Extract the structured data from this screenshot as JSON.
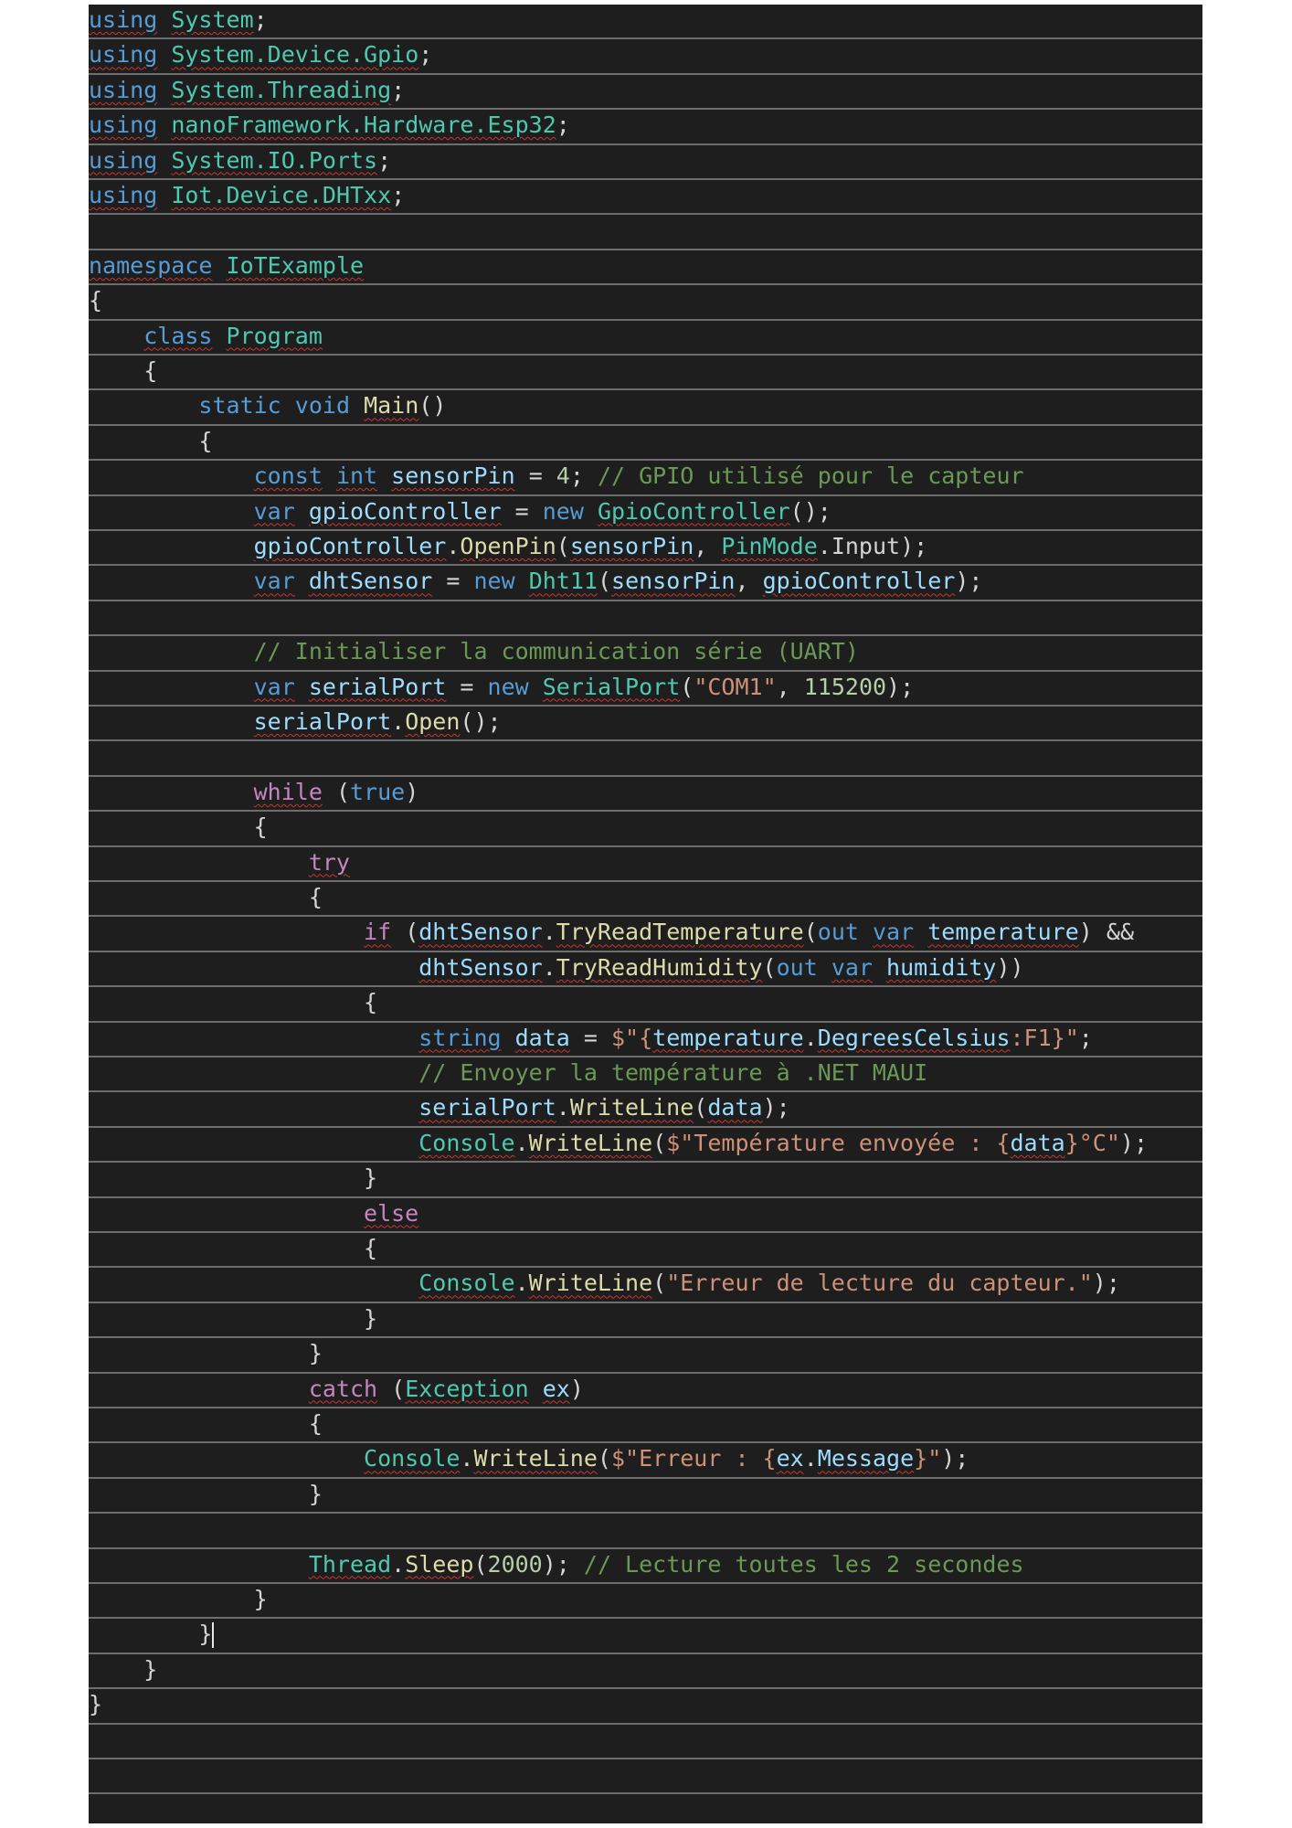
{
  "editor": {
    "background": "#1e1e1e",
    "line_separator_color": "#6e6e6e",
    "token_colors": {
      "keyword": "#569cd6",
      "control": "#c586c0",
      "type": "#4ec9b0",
      "method": "#dcdcaa",
      "variable": "#9cdcfe",
      "string": "#ce9178",
      "number": "#b5cea8",
      "comment": "#6a9955",
      "plain": "#d4d4d4"
    },
    "lines": [
      [
        [
          "kw",
          "using"
        ],
        [
          "plain",
          " "
        ],
        [
          "type",
          "System"
        ],
        [
          "plain",
          ";"
        ]
      ],
      [
        [
          "kw",
          "using"
        ],
        [
          "plain",
          " "
        ],
        [
          "type",
          "System.Device.Gpio"
        ],
        [
          "plain",
          ";"
        ]
      ],
      [
        [
          "kw",
          "using"
        ],
        [
          "plain",
          " "
        ],
        [
          "type",
          "System.Threading"
        ],
        [
          "plain",
          ";"
        ]
      ],
      [
        [
          "kw",
          "using"
        ],
        [
          "plain",
          " "
        ],
        [
          "type",
          "nanoFramework.Hardware.Esp32"
        ],
        [
          "plain",
          ";"
        ]
      ],
      [
        [
          "kw",
          "using"
        ],
        [
          "plain",
          " "
        ],
        [
          "type",
          "System.IO.Ports"
        ],
        [
          "plain",
          ";"
        ]
      ],
      [
        [
          "kw",
          "using"
        ],
        [
          "plain",
          " "
        ],
        [
          "type",
          "Iot.Device.DHTxx"
        ],
        [
          "plain",
          ";"
        ]
      ],
      [],
      [
        [
          "kw",
          "namespace"
        ],
        [
          "plain",
          " "
        ],
        [
          "type",
          "IoTExample"
        ]
      ],
      [
        [
          "plain",
          "{"
        ]
      ],
      [
        [
          "plain",
          "    "
        ],
        [
          "kw",
          "class"
        ],
        [
          "plain",
          " "
        ],
        [
          "type",
          "Program"
        ]
      ],
      [
        [
          "plain",
          "    {"
        ]
      ],
      [
        [
          "plain",
          "        "
        ],
        [
          "kw",
          "static"
        ],
        [
          "plain",
          " "
        ],
        [
          "kw",
          "void"
        ],
        [
          "plain",
          " "
        ],
        [
          "meth",
          "Main"
        ],
        [
          "plain",
          "()"
        ]
      ],
      [
        [
          "plain",
          "        {"
        ]
      ],
      [
        [
          "plain",
          "            "
        ],
        [
          "kw",
          "const"
        ],
        [
          "plain",
          " "
        ],
        [
          "kw",
          "int"
        ],
        [
          "plain",
          " "
        ],
        [
          "var",
          "sensorPin"
        ],
        [
          "plain",
          " = "
        ],
        [
          "num",
          "4"
        ],
        [
          "plain",
          "; "
        ],
        [
          "cmt",
          "// GPIO utilisé pour le capteur"
        ]
      ],
      [
        [
          "plain",
          "            "
        ],
        [
          "kw",
          "var"
        ],
        [
          "plain",
          " "
        ],
        [
          "var",
          "gpioController"
        ],
        [
          "plain",
          " = "
        ],
        [
          "kw",
          "new"
        ],
        [
          "plain",
          " "
        ],
        [
          "type",
          "GpioController"
        ],
        [
          "plain",
          "();"
        ]
      ],
      [
        [
          "plain",
          "            "
        ],
        [
          "var",
          "gpioController"
        ],
        [
          "plain",
          "."
        ],
        [
          "meth",
          "OpenPin"
        ],
        [
          "plain",
          "("
        ],
        [
          "var",
          "sensorPin"
        ],
        [
          "plain",
          ", "
        ],
        [
          "type",
          "PinMode"
        ],
        [
          "plain",
          ".Input);"
        ]
      ],
      [
        [
          "plain",
          "            "
        ],
        [
          "kw",
          "var"
        ],
        [
          "plain",
          " "
        ],
        [
          "var",
          "dhtSensor"
        ],
        [
          "plain",
          " = "
        ],
        [
          "kw",
          "new"
        ],
        [
          "plain",
          " "
        ],
        [
          "type",
          "Dht11"
        ],
        [
          "plain",
          "("
        ],
        [
          "var",
          "sensorPin"
        ],
        [
          "plain",
          ", "
        ],
        [
          "var",
          "gpioController"
        ],
        [
          "plain",
          ");"
        ]
      ],
      [],
      [
        [
          "plain",
          "            "
        ],
        [
          "cmt",
          "// Initialiser la communication série (UART)"
        ]
      ],
      [
        [
          "plain",
          "            "
        ],
        [
          "kw",
          "var"
        ],
        [
          "plain",
          " "
        ],
        [
          "var",
          "serialPort"
        ],
        [
          "plain",
          " = "
        ],
        [
          "kw",
          "new"
        ],
        [
          "plain",
          " "
        ],
        [
          "type",
          "SerialPort"
        ],
        [
          "plain",
          "("
        ],
        [
          "str",
          "\"COM1\""
        ],
        [
          "plain",
          ", "
        ],
        [
          "num",
          "115200"
        ],
        [
          "plain",
          ");"
        ]
      ],
      [
        [
          "plain",
          "            "
        ],
        [
          "var",
          "serialPort"
        ],
        [
          "plain",
          "."
        ],
        [
          "meth",
          "Open"
        ],
        [
          "plain",
          "();"
        ]
      ],
      [],
      [
        [
          "plain",
          "            "
        ],
        [
          "ctl",
          "while"
        ],
        [
          "plain",
          " ("
        ],
        [
          "kw",
          "true"
        ],
        [
          "plain",
          ")"
        ]
      ],
      [
        [
          "plain",
          "            {"
        ]
      ],
      [
        [
          "plain",
          "                "
        ],
        [
          "ctl",
          "try"
        ]
      ],
      [
        [
          "plain",
          "                {"
        ]
      ],
      [
        [
          "plain",
          "                    "
        ],
        [
          "ctl",
          "if"
        ],
        [
          "plain",
          " ("
        ],
        [
          "var",
          "dhtSensor"
        ],
        [
          "plain",
          "."
        ],
        [
          "meth",
          "TryReadTemperature"
        ],
        [
          "plain",
          "("
        ],
        [
          "kw",
          "out"
        ],
        [
          "plain",
          " "
        ],
        [
          "kw",
          "var"
        ],
        [
          "plain",
          " "
        ],
        [
          "var",
          "temperature"
        ],
        [
          "plain",
          ") &&"
        ]
      ],
      [
        [
          "plain",
          "                        "
        ],
        [
          "var",
          "dhtSensor"
        ],
        [
          "plain",
          "."
        ],
        [
          "meth",
          "TryReadHumidity"
        ],
        [
          "plain",
          "("
        ],
        [
          "kw",
          "out"
        ],
        [
          "plain",
          " "
        ],
        [
          "kw",
          "var"
        ],
        [
          "plain",
          " "
        ],
        [
          "var",
          "humidity"
        ],
        [
          "plain",
          "))"
        ]
      ],
      [
        [
          "plain",
          "                    {"
        ]
      ],
      [
        [
          "plain",
          "                        "
        ],
        [
          "kw",
          "string"
        ],
        [
          "plain",
          " "
        ],
        [
          "var",
          "data"
        ],
        [
          "plain",
          " = "
        ],
        [
          "str",
          "$\"{"
        ],
        [
          "var",
          "temperature"
        ],
        [
          "plain",
          "."
        ],
        [
          "var",
          "DegreesCelsius"
        ],
        [
          "str",
          ":F1}\""
        ],
        [
          "plain",
          ";"
        ]
      ],
      [
        [
          "plain",
          "                        "
        ],
        [
          "cmt",
          "// Envoyer la température à .NET MAUI"
        ]
      ],
      [
        [
          "plain",
          "                        "
        ],
        [
          "var",
          "serialPort"
        ],
        [
          "plain",
          "."
        ],
        [
          "meth",
          "WriteLine"
        ],
        [
          "plain",
          "("
        ],
        [
          "var",
          "data"
        ],
        [
          "plain",
          ");"
        ]
      ],
      [
        [
          "plain",
          "                        "
        ],
        [
          "type",
          "Console"
        ],
        [
          "plain",
          "."
        ],
        [
          "meth",
          "WriteLine"
        ],
        [
          "plain",
          "("
        ],
        [
          "str",
          "$\"Température envoyée : {"
        ],
        [
          "var",
          "data"
        ],
        [
          "str",
          "}°C\""
        ],
        [
          "plain",
          ");"
        ]
      ],
      [
        [
          "plain",
          "                    }"
        ]
      ],
      [
        [
          "plain",
          "                    "
        ],
        [
          "ctl",
          "else"
        ]
      ],
      [
        [
          "plain",
          "                    {"
        ]
      ],
      [
        [
          "plain",
          "                        "
        ],
        [
          "type",
          "Console"
        ],
        [
          "plain",
          "."
        ],
        [
          "meth",
          "WriteLine"
        ],
        [
          "plain",
          "("
        ],
        [
          "str",
          "\"Erreur de lecture du capteur.\""
        ],
        [
          "plain",
          ");"
        ]
      ],
      [
        [
          "plain",
          "                    }"
        ]
      ],
      [
        [
          "plain",
          "                }"
        ]
      ],
      [
        [
          "plain",
          "                "
        ],
        [
          "ctl",
          "catch"
        ],
        [
          "plain",
          " ("
        ],
        [
          "type",
          "Exception"
        ],
        [
          "plain",
          " "
        ],
        [
          "var",
          "ex"
        ],
        [
          "plain",
          ")"
        ]
      ],
      [
        [
          "plain",
          "                {"
        ]
      ],
      [
        [
          "plain",
          "                    "
        ],
        [
          "type",
          "Console"
        ],
        [
          "plain",
          "."
        ],
        [
          "meth",
          "WriteLine"
        ],
        [
          "plain",
          "("
        ],
        [
          "str",
          "$\"Erreur : {"
        ],
        [
          "var",
          "ex"
        ],
        [
          "plain",
          "."
        ],
        [
          "var",
          "Message"
        ],
        [
          "str",
          "}\""
        ],
        [
          "plain",
          ");"
        ]
      ],
      [
        [
          "plain",
          "                }"
        ]
      ],
      [],
      [
        [
          "plain",
          "                "
        ],
        [
          "type",
          "Thread"
        ],
        [
          "plain",
          "."
        ],
        [
          "meth",
          "Sleep"
        ],
        [
          "plain",
          "("
        ],
        [
          "num",
          "2000"
        ],
        [
          "plain",
          "); "
        ],
        [
          "cmt",
          "// Lecture toutes les 2 secondes"
        ]
      ],
      [
        [
          "plain",
          "            }"
        ]
      ],
      [
        [
          "plain",
          "        }"
        ],
        [
          "cursor",
          ""
        ]
      ],
      [
        [
          "plain",
          "    }"
        ]
      ],
      [
        [
          "plain",
          "}"
        ]
      ],
      [],
      [],
      []
    ]
  }
}
